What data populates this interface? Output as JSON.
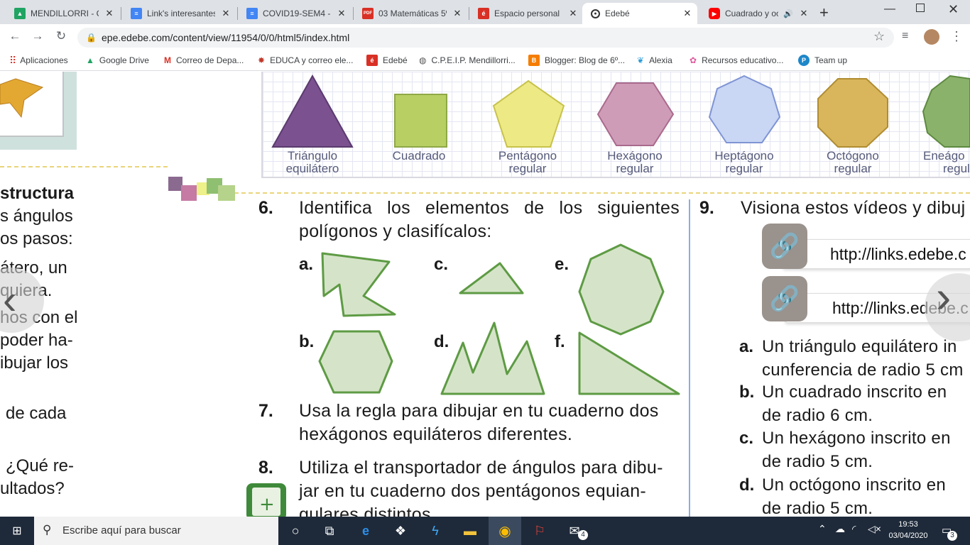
{
  "tabs": [
    {
      "title": "MENDILLORRI - G",
      "icon": "google-drive-icon"
    },
    {
      "title": "Link's interesantes",
      "icon": "docs-icon"
    },
    {
      "title": "COVID19-SEM4 - D",
      "icon": "docs-icon"
    },
    {
      "title": "03 Matemáticas 5º",
      "icon": "pdf-icon"
    },
    {
      "title": "Espacio personal E",
      "icon": "edebe-icon"
    },
    {
      "title": "Edebé",
      "icon": "edebe-icon"
    },
    {
      "title": "Cuadrado y oc",
      "icon": "youtube-icon"
    }
  ],
  "url": "epe.edebe.com/content/view/11954/0/0/html5/index.html",
  "bookmarks": [
    "Aplicaciones",
    "Google Drive",
    "Correo de Depa...",
    "EDUCA y correo ele...",
    "Edebé",
    "C.P.E.I.P. Mendillorri...",
    "Blogger: Blog de 6º...",
    "Alexia",
    "Recursos educativo...",
    "Team up"
  ],
  "shapes": [
    {
      "l1": "Triángulo",
      "l2": "equilátero",
      "color": "#7b5190"
    },
    {
      "l1": "Cuadrado",
      "l2": "",
      "color": "#b7cf63"
    },
    {
      "l1": "Pentágono",
      "l2": "regular",
      "color": "#ede985"
    },
    {
      "l1": "Hexágono",
      "l2": "regular",
      "color": "#cf9cb8"
    },
    {
      "l1": "Heptágono",
      "l2": "regular",
      "color": "#c9d6f4"
    },
    {
      "l1": "Octógono",
      "l2": "regular",
      "color": "#d9b65c"
    },
    {
      "l1": "Eneágo",
      "l2": "regul",
      "color": "#8bb26b"
    }
  ],
  "left": {
    "lines": [
      "structura",
      "s ángulos",
      "os pasos:",
      "átero, un",
      "quiera.",
      "hos con el",
      "poder ha-",
      "ibujar los",
      "de cada",
      "¿Qué re-",
      "ultados?"
    ]
  },
  "ex6": {
    "num": "6.",
    "l1": "Identifica los elementos de los siguientes",
    "l2": "polígonos y clasifícalos:"
  },
  "poly_labels": [
    "a.",
    "b.",
    "c.",
    "d.",
    "e.",
    "f."
  ],
  "ex7": {
    "num": "7.",
    "l1": "Usa la regla para dibujar en tu cuaderno dos",
    "l2": "hexágonos equiláteros diferentes."
  },
  "ex8": {
    "num": "8.",
    "l1": "Utiliza el transportador de ángulos para dibu-",
    "l2": "jar en tu cuaderno dos pentágonos equian-",
    "l3": "gulares distintos."
  },
  "ex9": {
    "num": "9.",
    "l1": "Visiona estos vídeos y dibuj"
  },
  "links": [
    "http://links.edebe.c",
    "http://links.edebe.c"
  ],
  "items9": [
    {
      "label": "a.",
      "l1": "Un triángulo equilátero in",
      "l2": "cunferencia de radio 5 cm"
    },
    {
      "label": "b.",
      "l1": "Un cuadrado inscrito en",
      "l2": "de radio 6 cm."
    },
    {
      "label": "c.",
      "l1": "Un hexágono inscrito en",
      "l2": "de radio 5 cm."
    },
    {
      "label": "d.",
      "l1": "Un octógono inscrito en",
      "l2": "de radio 5 cm."
    }
  ],
  "taskbar": {
    "search": "Escribe aquí para buscar",
    "time": "19:53",
    "date": "03/04/2020",
    "mail_badge": "4",
    "notif_badge": "3"
  }
}
